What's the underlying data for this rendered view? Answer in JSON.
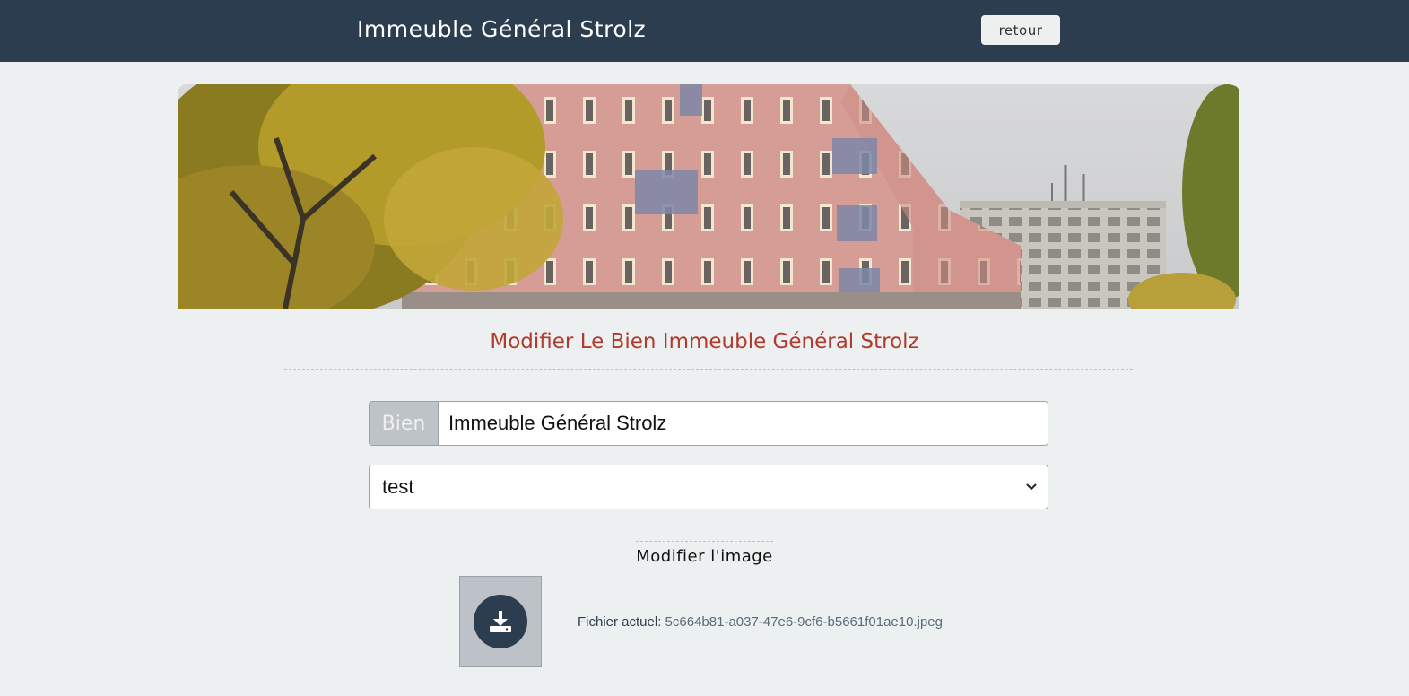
{
  "header": {
    "title": "Immeuble Général Strolz",
    "back_label": "retour"
  },
  "banner": {
    "description_icon": "building-photo"
  },
  "form": {
    "heading": "Modifier Le Bien Immeuble Général Strolz",
    "name_addon": "Bien",
    "name_value": "Immeuble Général Strolz",
    "select_value": "test"
  },
  "image_section": {
    "title": "Modifier l'image",
    "upload_icon": "download-icon",
    "current_file_label": "Fichier actuel:",
    "current_file_name": "5c664b81-a037-47e6-9cf6-b5661f01ae10.jpeg"
  },
  "colors": {
    "topbar": "#2d3d50",
    "background": "#edf0f0",
    "heading": "#b03a2e"
  }
}
